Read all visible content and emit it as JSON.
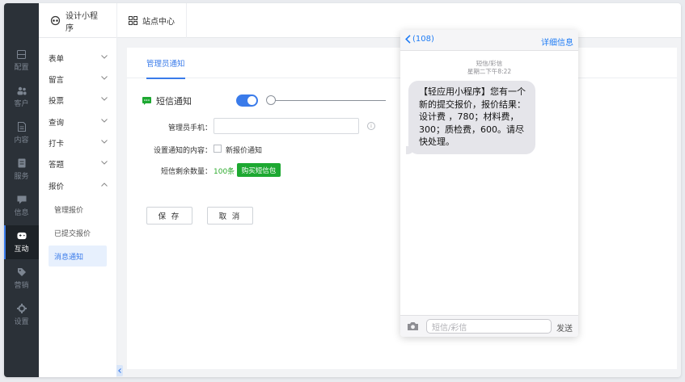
{
  "rail": {
    "items": [
      {
        "label": "配置",
        "icon": "config-icon"
      },
      {
        "label": "客户",
        "icon": "customers-icon"
      },
      {
        "label": "内容",
        "icon": "content-icon"
      },
      {
        "label": "服务",
        "icon": "service-icon"
      },
      {
        "label": "信息",
        "icon": "message-icon"
      },
      {
        "label": "互动",
        "icon": "gamepad-icon",
        "active": true
      },
      {
        "label": "营销",
        "icon": "tag-icon"
      },
      {
        "label": "设置",
        "icon": "settings-icon"
      }
    ]
  },
  "topbar": {
    "app_label": "设计小程序",
    "site_label": "站点中心"
  },
  "submenu": {
    "items": [
      "表单",
      "留言",
      "投票",
      "查询",
      "打卡",
      "答题",
      "报价"
    ],
    "sub_items": [
      "管理报价",
      "已提交报价",
      "消息通知"
    ],
    "active_sub": "消息通知"
  },
  "content": {
    "tab_label": "管理员通知",
    "section_title": "短信通知",
    "toggle_on": true,
    "phone_label": "管理员手机：",
    "phone_value": "",
    "info_glyph": "i",
    "notify_label": "设置通知的内容：",
    "notify_option": "新报价通知",
    "notify_checked": false,
    "remain_label": "短信剩余数量：",
    "remain_value": "100条",
    "buy_button": "购买短信包",
    "save_button": "保 存",
    "cancel_button": "取 消"
  },
  "phone_preview": {
    "back_label": "(108)",
    "detail_label": "详细信息",
    "meta_type": "短信/彩信",
    "meta_time": "星期二下午8:22",
    "message": "【轻应用小程序】您有一个新的提交报价，报价结果：设计费 ，780；材料费，300；质检费，600。请尽快处理。",
    "input_placeholder": "短信/彩信",
    "send_label": "发送"
  },
  "colors": {
    "accent": "#3a7bea",
    "rail_bg": "#2b3138",
    "success": "#1da831",
    "ios_blue": "#1f7cf5"
  }
}
